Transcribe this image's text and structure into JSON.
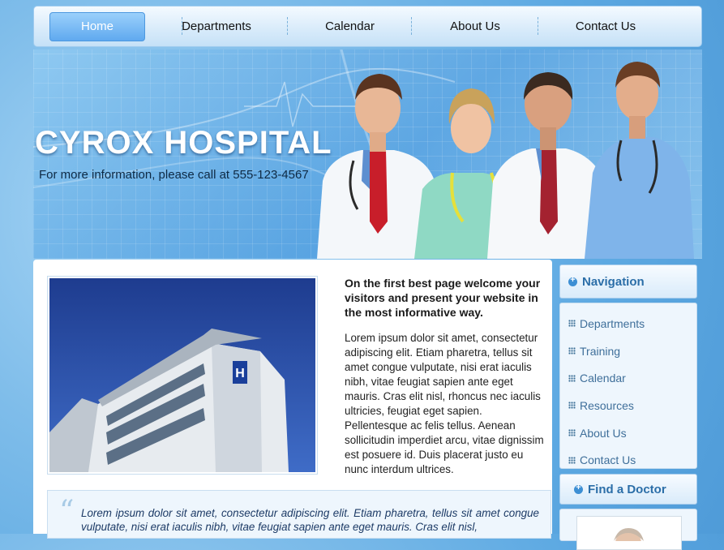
{
  "nav": {
    "items": [
      {
        "label": "Home",
        "active": true
      },
      {
        "label": "Departments",
        "active": false
      },
      {
        "label": "Calendar",
        "active": false
      },
      {
        "label": "About Us",
        "active": false
      },
      {
        "label": "Contact Us",
        "active": false
      }
    ]
  },
  "header": {
    "title": "CYROX HOSPITAL",
    "subtitle": "For more information, please call at 555-123-4567"
  },
  "intro": {
    "title": "On the first best page  welcome your visitors and present your website in the most informative way.",
    "body": "Lorem ipsum dolor sit amet, consectetur adipiscing elit. Etiam pharetra, tellus sit amet congue vulputate, nisi erat iaculis nibh, vitae feugiat sapien ante eget mauris. Cras elit nisl, rhoncus nec iaculis ultricies, feugiat eget sapien. Pellentesque ac felis tellus. Aenean sollicitudin imperdiet arcu, vitae dignissim est posuere id. Duis placerat justo eu nunc interdum ultrices."
  },
  "quote": {
    "mark": "“",
    "text": "Lorem ipsum dolor sit amet, consectetur adipiscing elit. Etiam pharetra, tellus sit amet congue vulputate, nisi erat iaculis nibh, vitae feugiat sapien ante eget mauris. Cras elit nisl,"
  },
  "sidebar": {
    "navigation_title": "Navigation",
    "items": [
      {
        "label": "Departments"
      },
      {
        "label": "Training"
      },
      {
        "label": "Calendar"
      },
      {
        "label": "Resources"
      },
      {
        "label": "About Us"
      },
      {
        "label": "Contact Us"
      }
    ],
    "find_doctor_title": "Find a Doctor"
  },
  "photo": {
    "sign_letter": "H"
  },
  "colors": {
    "accent": "#3d8fd4",
    "nav_active": "#5fa9ef",
    "title_text": "#ffffff",
    "sidebar_text": "#3f6f9a"
  },
  "icons": {
    "sidebar_bullet": "dotted-grid-icon",
    "section_heading": "plus-circle-icon",
    "quote": "quote-icon"
  }
}
